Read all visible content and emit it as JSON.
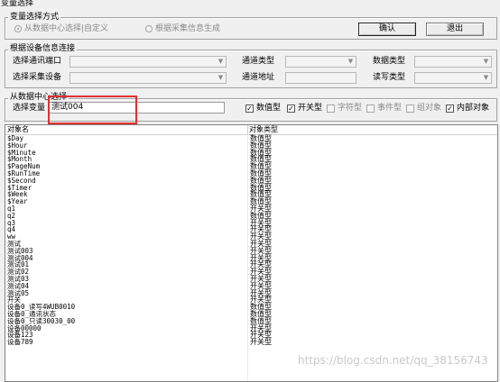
{
  "window": {
    "title": "变量选择"
  },
  "mode_group": {
    "legend": "变量选择方式",
    "option1": "从数据中心选择|自定义",
    "option2": "根据采集信息生成",
    "ok_label": "确认",
    "cancel_label": "退出"
  },
  "device_group": {
    "legend": "根据设备信息连接",
    "port_label": "选择通讯端口",
    "device_label": "选择采集设备",
    "channel_type_label": "通道类型",
    "channel_addr_label": "通道地址",
    "data_type_label": "数据类型",
    "rw_type_label": "读写类型"
  },
  "center_group": {
    "legend": "从数据中心选择",
    "select_var_label": "选择变量",
    "select_var_value": "测试004",
    "filters": [
      {
        "label": "数值型",
        "checked": true
      },
      {
        "label": "开关型",
        "checked": true
      },
      {
        "label": "字符型",
        "checked": false
      },
      {
        "label": "事件型",
        "checked": false
      },
      {
        "label": "组对象",
        "checked": false
      },
      {
        "label": "内部对象",
        "checked": true
      }
    ]
  },
  "table": {
    "col_name": "对象名",
    "col_type": "对象类型",
    "rows": [
      {
        "name": "$Day",
        "type": "数值型"
      },
      {
        "name": "$Hour",
        "type": "数值型"
      },
      {
        "name": "$Minute",
        "type": "数值型"
      },
      {
        "name": "$Month",
        "type": "数值型"
      },
      {
        "name": "$PageNum",
        "type": "数值型"
      },
      {
        "name": "$RunTime",
        "type": "数值型"
      },
      {
        "name": "$Second",
        "type": "数值型"
      },
      {
        "name": "$Timer",
        "type": "数值型"
      },
      {
        "name": "$Week",
        "type": "数值型"
      },
      {
        "name": "$Year",
        "type": "数值型"
      },
      {
        "name": "q1",
        "type": "开关型"
      },
      {
        "name": "q2",
        "type": "数值型"
      },
      {
        "name": "q3",
        "type": "开关型"
      },
      {
        "name": "q4",
        "type": "开关型"
      },
      {
        "name": "ww",
        "type": "开关型"
      },
      {
        "name": "测试",
        "type": "开关型"
      },
      {
        "name": "测试003",
        "type": "开关型"
      },
      {
        "name": "测试004",
        "type": "开关型"
      },
      {
        "name": "测试01",
        "type": "开关型"
      },
      {
        "name": "测试02",
        "type": "开关型"
      },
      {
        "name": "测试03",
        "type": "开关型"
      },
      {
        "name": "测试04",
        "type": "开关型"
      },
      {
        "name": "测试05",
        "type": "开关型"
      },
      {
        "name": "开关",
        "type": "开关型"
      },
      {
        "name": "设备0_读写4WUB0010",
        "type": "数值型"
      },
      {
        "name": "设备0_通讯状态",
        "type": "数值型"
      },
      {
        "name": "设备0_只读30030_00",
        "type": "数值型"
      },
      {
        "name": "设备00000",
        "type": "开关型"
      },
      {
        "name": "设备123",
        "type": "开关型"
      },
      {
        "name": "设备789",
        "type": "开关型"
      }
    ]
  },
  "watermark": "https://blog.csdn.net/qq_38156743",
  "colors": {
    "highlight_box": "#e03030"
  }
}
